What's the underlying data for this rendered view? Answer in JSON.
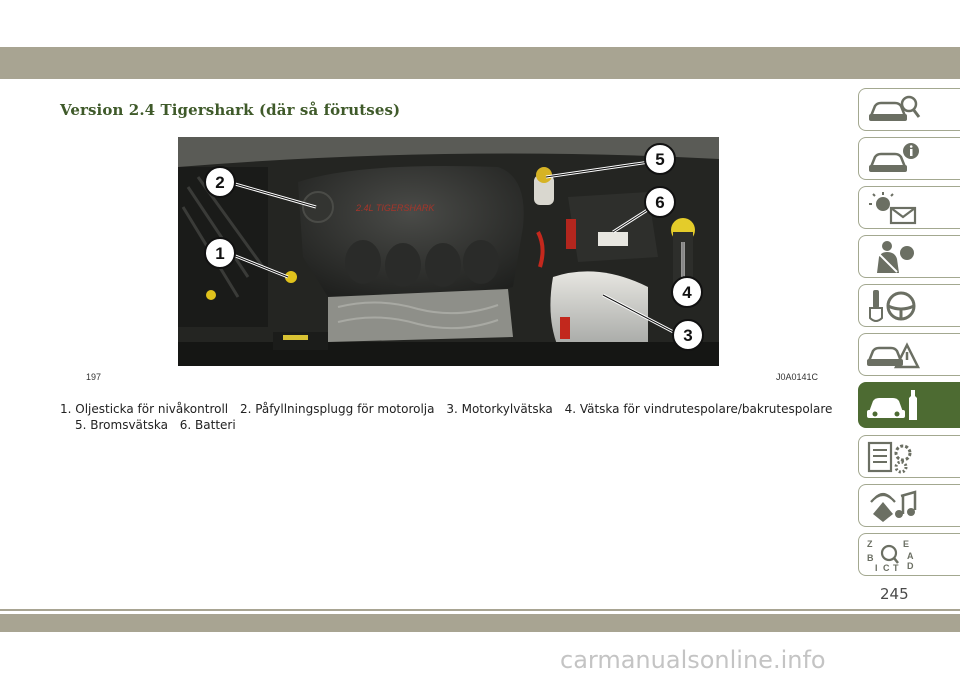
{
  "section": {
    "title": "Version 2.4 Tigershark (där så förutses)"
  },
  "figure": {
    "number": "197",
    "code": "J0A0141C",
    "engine_cover_text": "2.4L TIGERSHARK",
    "callouts": [
      "1",
      "2",
      "3",
      "4",
      "5",
      "6"
    ]
  },
  "caption": {
    "items": [
      "1. Oljesticka för nivåkontroll",
      "2. Påfyllningsplugg för motorolja",
      "3. Motorkylvätska",
      "4. Vätska för vindrutespolare/bakrutespolare",
      "5. Bromsvätska",
      "6. Batteri"
    ]
  },
  "side_tabs": [
    {
      "icon": "car-magnifier-icon",
      "active": false
    },
    {
      "icon": "car-info-icon",
      "active": false
    },
    {
      "icon": "warning-light-envelope-icon",
      "active": false
    },
    {
      "icon": "person-seatbelt-airbag-icon",
      "active": false
    },
    {
      "icon": "key-steering-wheel-icon",
      "active": false
    },
    {
      "icon": "car-triangle-warning-icon",
      "active": false
    },
    {
      "icon": "car-wrench-icon",
      "active": true
    },
    {
      "icon": "document-gears-icon",
      "active": false
    },
    {
      "icon": "radio-music-icon",
      "active": false
    },
    {
      "icon": "alphabet-index-magnifier-icon",
      "active": false
    }
  ],
  "page": {
    "number": "245"
  },
  "watermark": "carmanualsonline.info",
  "colors": {
    "band": "#a8a492",
    "accent": "#4d6b32",
    "title": "#3f5a2a"
  }
}
